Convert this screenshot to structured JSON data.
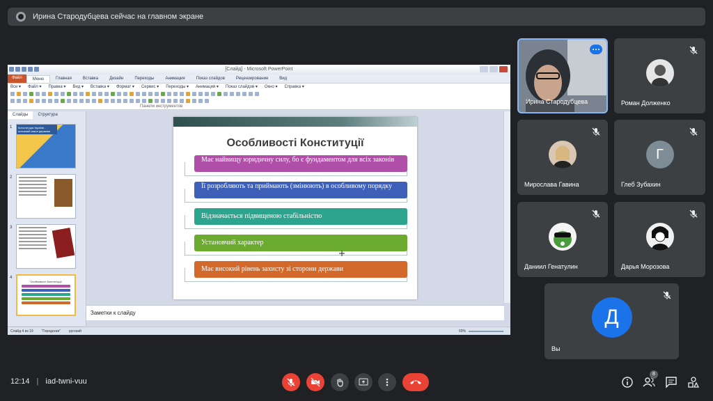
{
  "banner": {
    "text": "Ирина Стародубцева сейчас на главном экране"
  },
  "ppt": {
    "window_title": "[Слайд] - Microsoft PowerPoint",
    "tabs": [
      "Файл",
      "Меню",
      "Главная",
      "Вставка",
      "Дизайн",
      "Переходы",
      "Анимация",
      "Показ слайдов",
      "Рецензирование",
      "Вид"
    ],
    "menu": [
      "Все ▾",
      "Файл ▾",
      "Правка ▾",
      "Вид ▾",
      "Вставка ▾",
      "Формат ▾",
      "Сервис ▾",
      "Переходы ▾",
      "Анимация ▾",
      "Показ слайдов ▾",
      "Окно ▾",
      "Справка ▾"
    ],
    "toolbar_group": "Панели инструментов",
    "panel_tabs": [
      "Слайды",
      "Структура"
    ],
    "thumbs": [
      {
        "num": "1",
        "text": "Конституція України - основний закон держави"
      },
      {
        "num": "2"
      },
      {
        "num": "3"
      },
      {
        "num": "4",
        "text": "Особливості Конституції"
      }
    ],
    "slide": {
      "title": "Особливості Конституції",
      "items": [
        {
          "text": "Має найвищу юридичну силу, бо є фундаментом для всіх законів",
          "color": "#b04fa8"
        },
        {
          "text": "Її розробляють та приймають (змінюють) в особливому порядку",
          "color": "#3e5fb7"
        },
        {
          "text": "Відзначається підвищеною стабільністю",
          "color": "#2da58e"
        },
        {
          "text": "Установчий характер",
          "color": "#6aaa2f"
        },
        {
          "text": "Має високий рівень захисту зі сторони держави",
          "color": "#d2692a"
        }
      ]
    },
    "notes_placeholder": "Заметки к слайду",
    "status": {
      "slide": "Слайд 4 из 19",
      "theme": "\"Городская\"",
      "lang": "русский",
      "zoom": "69%"
    }
  },
  "participants": [
    {
      "name": "Ирина Стародубцева"
    },
    {
      "name": "Роман Долженко"
    },
    {
      "name": "Мирослава Гавина"
    },
    {
      "name": "Глеб Зубахин",
      "initial": "Г",
      "color": "#7e8c95"
    },
    {
      "name": "Даниил Генатулин"
    },
    {
      "name": "Дарья Морозова"
    },
    {
      "name": "Вы",
      "initial": "Д",
      "color": "#1a73e8"
    }
  ],
  "bottom": {
    "time": "12:14",
    "separator": "|",
    "meeting_code": "iad-twni-vuu",
    "people_count": "8"
  },
  "colors": {
    "end_call": "#ea4335",
    "accent": "#8ab4f8"
  }
}
